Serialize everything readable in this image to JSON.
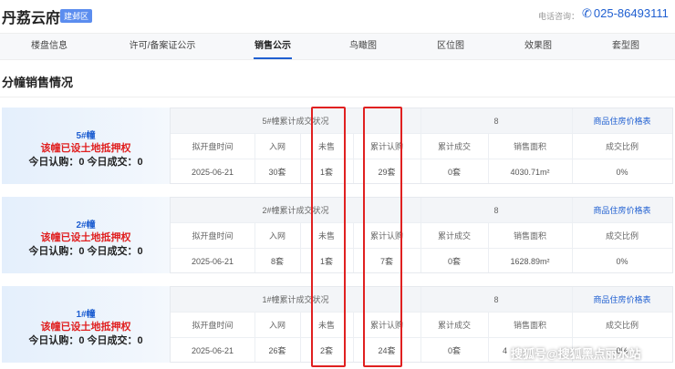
{
  "header": {
    "title": "丹荔云府",
    "district": "建邺区",
    "tel_label": "电话咨询：",
    "tel_icon": "phone-icon",
    "tel": "025-86493111"
  },
  "nav": {
    "tabs": [
      "楼盘信息",
      "许可/备案证公示",
      "销售公示",
      "鸟瞰图",
      "区位图",
      "效果图",
      "套型图"
    ],
    "active_index": 2
  },
  "section_title": "分幢销售情况",
  "blocks": [
    {
      "name": "5#幢",
      "mortgage": "该幢已设土地抵押权",
      "today": "今日认购：0 今日成交：0",
      "summary_title": "5#幢累计成交状况",
      "summary_value": "8",
      "price_link": "商品住房价格表",
      "headers": [
        "拟开盘时间",
        "入网",
        "未售",
        "累计认购",
        "累计成交",
        "销售面积",
        "成交比例"
      ],
      "values": [
        "2025-06-21",
        "30套",
        "1套",
        "29套",
        "0套",
        "4030.71m²",
        "0%"
      ]
    },
    {
      "name": "2#幢",
      "mortgage": "该幢已设土地抵押权",
      "today": "今日认购：0 今日成交：0",
      "summary_title": "2#幢累计成交状况",
      "summary_value": "8",
      "price_link": "商品住房价格表",
      "headers": [
        "拟开盘时间",
        "入网",
        "未售",
        "累计认购",
        "累计成交",
        "销售面积",
        "成交比例"
      ],
      "values": [
        "2025-06-21",
        "8套",
        "1套",
        "7套",
        "0套",
        "1628.89m²",
        "0%"
      ]
    },
    {
      "name": "1#幢",
      "mortgage": "该幢已设土地抵押权",
      "today": "今日认购：0 今日成交：0",
      "summary_title": "1#幢累计成交状况",
      "summary_value": "8",
      "price_link": "商品住房价格表",
      "headers": [
        "拟开盘时间",
        "入网",
        "未售",
        "累计认购",
        "累计成交",
        "销售面积",
        "成交比例"
      ],
      "values": [
        "2025-06-21",
        "26套",
        "2套",
        "24套",
        "0套",
        "4",
        "0%"
      ]
    }
  ],
  "footer_watermark": "搜狐号@搜狐黑点丽水站",
  "colors": {
    "accent": "#1f5fd1",
    "alert": "#e02020",
    "card_bg": "#e4effc"
  }
}
